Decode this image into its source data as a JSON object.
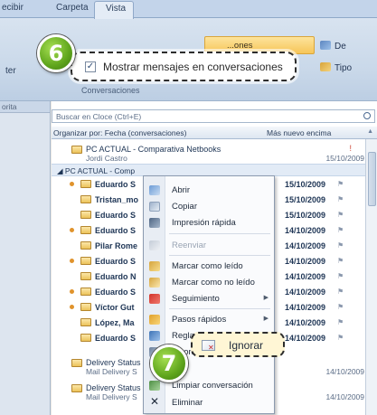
{
  "ribbon": {
    "tabs": [
      "ecibir",
      "Carpeta",
      "Vista"
    ],
    "left_text": "ter",
    "right_button_label": "...ones",
    "de_label": "De",
    "tipo_label": "Tipo",
    "group_label": "Conversaciones",
    "show_conversations_label": "Mostrar mensajes en conversaciones"
  },
  "left_pane": {
    "header": "orita"
  },
  "mail": {
    "search_placeholder": "Buscar en Cloce (Ctrl+E)",
    "arrange_left": "Organizar por: Fecha (conversaciones)",
    "arrange_right": "Más nuevo encima",
    "conversation_1": {
      "subject": "PC ACTUAL - Comparativa Netbooks",
      "sender": "Jordi Castro",
      "date": "15/10/2009"
    },
    "conversation_group": "PC ACTUAL - Comp",
    "rows": [
      {
        "name": "Eduardo S",
        "date": "15/10/2009"
      },
      {
        "name": "Tristan_mo",
        "date": "15/10/2009"
      },
      {
        "name": "Eduardo S",
        "date": "15/10/2009"
      },
      {
        "name": "Eduardo S",
        "date": "14/10/2009"
      },
      {
        "name": "Pilar Rome",
        "date": "14/10/2009"
      },
      {
        "name": "Eduardo S",
        "date": "14/10/2009"
      },
      {
        "name": "Eduardo N",
        "date": "14/10/2009"
      },
      {
        "name": "Eduardo S",
        "date": "14/10/2009"
      },
      {
        "name": "Víctor Gut",
        "date": "14/10/2009"
      },
      {
        "name": "López, Ma",
        "date": "14/10/2009"
      },
      {
        "name": "Eduardo S",
        "date": "14/10/2009"
      }
    ],
    "delivery_1": {
      "subject": "Delivery Status",
      "sender": "Mail Delivery S",
      "date": "14/10/2009"
    },
    "delivery_2": {
      "subject": "Delivery Status",
      "sender": "Mail Delivery S",
      "date": "14/10/2009"
    }
  },
  "context_menu": {
    "abrir": "Abrir",
    "copiar": "Copiar",
    "impresion": "Impresión rápida",
    "reenviar": "Reenviar",
    "marcar_leido": "Marcar como leído",
    "marcar_no_leido": "Marcar como no leído",
    "seguimiento": "Seguimiento",
    "pasos": "Pasos rápidos",
    "reglas": "Regla",
    "ignorar": "Ignorar",
    "limpiar": "Limpiar conversación",
    "eliminar": "Eliminar"
  },
  "callouts": {
    "step_6": "6",
    "step_7": "7"
  },
  "colors": {
    "badge_green": "#5fa51c",
    "ribbon_blue": "#c9d8e9",
    "highlight": "#f6c558"
  },
  "icons": [
    "search-icon",
    "envelope-icon",
    "flag-icon",
    "checkbox-icon",
    "delete-icon"
  ]
}
